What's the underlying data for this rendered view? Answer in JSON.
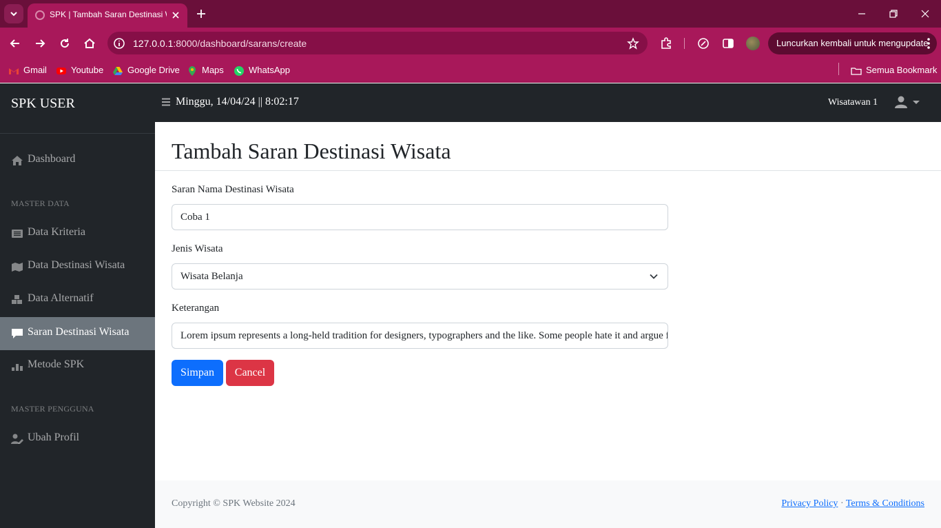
{
  "browser": {
    "tab_title": "SPK | Tambah Saran Destinasi W",
    "url_host": "127.0.0.1",
    "url_rest": ":8000/dashboard/sarans/create",
    "update_label": "Luncurkan kembali untuk mengupdate",
    "bookmarks": [
      {
        "label": "Gmail",
        "icon": "gmail-icon",
        "color": "#ea4335"
      },
      {
        "label": "Youtube",
        "icon": "youtube-icon",
        "color": "#ff0000"
      },
      {
        "label": "Google Drive",
        "icon": "google-drive-icon",
        "color": "#fbbc04"
      },
      {
        "label": "Maps",
        "icon": "maps-icon",
        "color": "#34a853"
      },
      {
        "label": "WhatsApp",
        "icon": "whatsapp-icon",
        "color": "#25d366"
      }
    ],
    "all_bookmarks_label": "Semua Bookmark"
  },
  "sidebar": {
    "brand": "SPK USER",
    "items": [
      {
        "label": "Dashboard",
        "icon": "home-icon"
      },
      {
        "label": "Data Kriteria",
        "icon": "list-icon"
      },
      {
        "label": "Data Destinasi Wisata",
        "icon": "map-icon"
      },
      {
        "label": "Data Alternatif",
        "icon": "cubes-icon"
      },
      {
        "label": "Saran Destinasi Wisata",
        "icon": "comment-icon",
        "active": true
      },
      {
        "label": "Metode SPK",
        "icon": "chart-icon"
      },
      {
        "label": "Ubah Profil",
        "icon": "user-edit-icon"
      }
    ],
    "headings": [
      "MASTER DATA",
      "MASTER PENGGUNA"
    ]
  },
  "topbar": {
    "datetime": "Minggu, 14/04/24 || 8:02:17",
    "user_name": "Wisatawan 1"
  },
  "main": {
    "title": "Tambah Saran Destinasi Wisata",
    "fields": {
      "name_label": "Saran Nama Destinasi Wisata",
      "name_value": "Coba 1",
      "type_label": "Jenis Wisata",
      "type_value": "Wisata Belanja",
      "desc_label": "Keterangan",
      "desc_value": "Lorem ipsum represents a long-held tradition for designers, typographers and the like. Some people hate it and argue for its demise"
    },
    "save_label": "Simpan",
    "cancel_label": "Cancel"
  },
  "footer": {
    "copyright": "Copyright © SPK Website 2024",
    "privacy": "Privacy Policy",
    "separator": "·",
    "terms": "Terms & Conditions"
  },
  "colors": {
    "browser_frame": "#a8185a",
    "sidebar_bg": "#212529",
    "primary": "#0d6efd",
    "danger": "#dc3545",
    "active_item": "#6c757d"
  }
}
